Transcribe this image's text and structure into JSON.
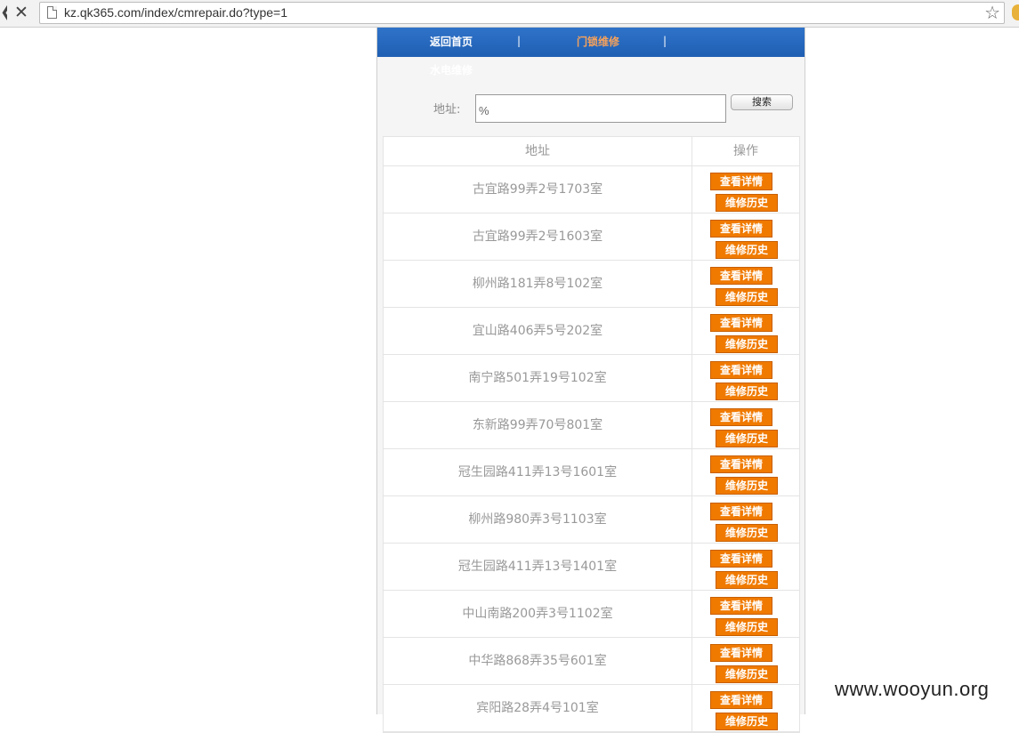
{
  "browser": {
    "url": "kz.qk365.com/index/cmrepair.do?type=1",
    "back_glyph": "❮",
    "stop_glyph": "✕",
    "star_glyph": "☆"
  },
  "nav": {
    "home": "返回首页",
    "separator": "|",
    "lock_repair": "门锁维修",
    "water_repair": "水电维修"
  },
  "search": {
    "label": "地址:",
    "value": "%",
    "button": "搜索"
  },
  "table": {
    "headers": [
      "地址",
      "操作"
    ],
    "detail_label": "查看详情",
    "history_label": "维修历史",
    "rows": [
      "古宜路99弄2号1703室",
      "古宜路99弄2号1603室",
      "柳州路181弄8号102室",
      "宜山路406弄5号202室",
      "南宁路501弄19号102室",
      "东新路99弄70号801室",
      "冠生园路411弄13号1601室",
      "柳州路980弄3号1103室",
      "冠生园路411弄13号1401室",
      "中山南路200弄3号1102室",
      "中华路868弄35号601室",
      "宾阳路28弄4号101室"
    ]
  },
  "watermark": "www.wooyun.org",
  "colors": {
    "topbar": "#2466bb",
    "active_nav": "#f7a25b",
    "button": "#f07a00"
  }
}
